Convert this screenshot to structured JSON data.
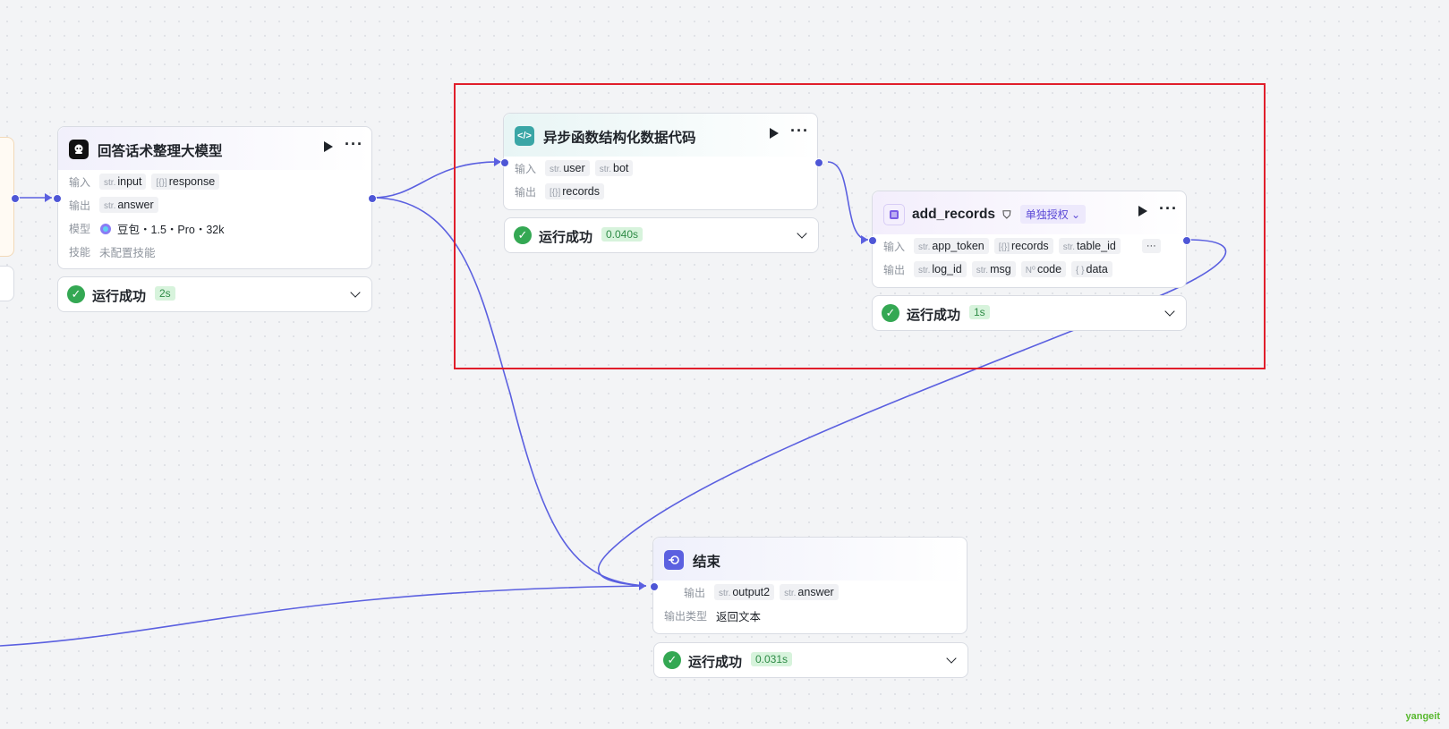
{
  "llm_node": {
    "title": "回答话术整理大模型",
    "input_label": "输入",
    "inputs": [
      {
        "type": "str.",
        "name": "input"
      },
      {
        "type": "[{}]",
        "name": "response"
      }
    ],
    "output_label": "输出",
    "outputs": [
      {
        "type": "str.",
        "name": "answer"
      }
    ],
    "model_label": "模型",
    "model_value": "豆包・1.5・Pro・32k",
    "skill_label": "技能",
    "skill_value": "未配置技能",
    "status": "运行成功",
    "duration": "2s"
  },
  "code_node": {
    "title": "异步函数结构化数据代码",
    "input_label": "输入",
    "inputs": [
      {
        "type": "str.",
        "name": "user"
      },
      {
        "type": "str.",
        "name": "bot"
      }
    ],
    "output_label": "输出",
    "outputs": [
      {
        "type": "[{}]",
        "name": "records"
      }
    ],
    "status": "运行成功",
    "duration": "0.040s"
  },
  "plugin_node": {
    "title": "add_records",
    "auth_label": "单独授权",
    "input_label": "输入",
    "inputs": [
      {
        "type": "str.",
        "name": "app_token"
      },
      {
        "type": "[{}]",
        "name": "records"
      },
      {
        "type": "str.",
        "name": "table_id"
      }
    ],
    "overflow_label": "···",
    "output_label": "输出",
    "outputs": [
      {
        "type": "str.",
        "name": "log_id"
      },
      {
        "type": "str.",
        "name": "msg"
      },
      {
        "type": "N⁰",
        "name": "code"
      },
      {
        "type": "{ }",
        "name": "data"
      }
    ],
    "status": "运行成功",
    "duration": "1s"
  },
  "end_node": {
    "title": "结束",
    "output_label": "输出",
    "outputs": [
      {
        "type": "str.",
        "name": "output2"
      },
      {
        "type": "str.",
        "name": "answer"
      }
    ],
    "output_type_label": "输出类型",
    "output_type_value": "返回文本",
    "status": "运行成功",
    "duration": "0.031s"
  },
  "watermark": "yangeit",
  "colors": {
    "edge": "#5b60e0",
    "port": "#4e56d6",
    "success": "#34a853",
    "highlight": "#e01e2b"
  }
}
